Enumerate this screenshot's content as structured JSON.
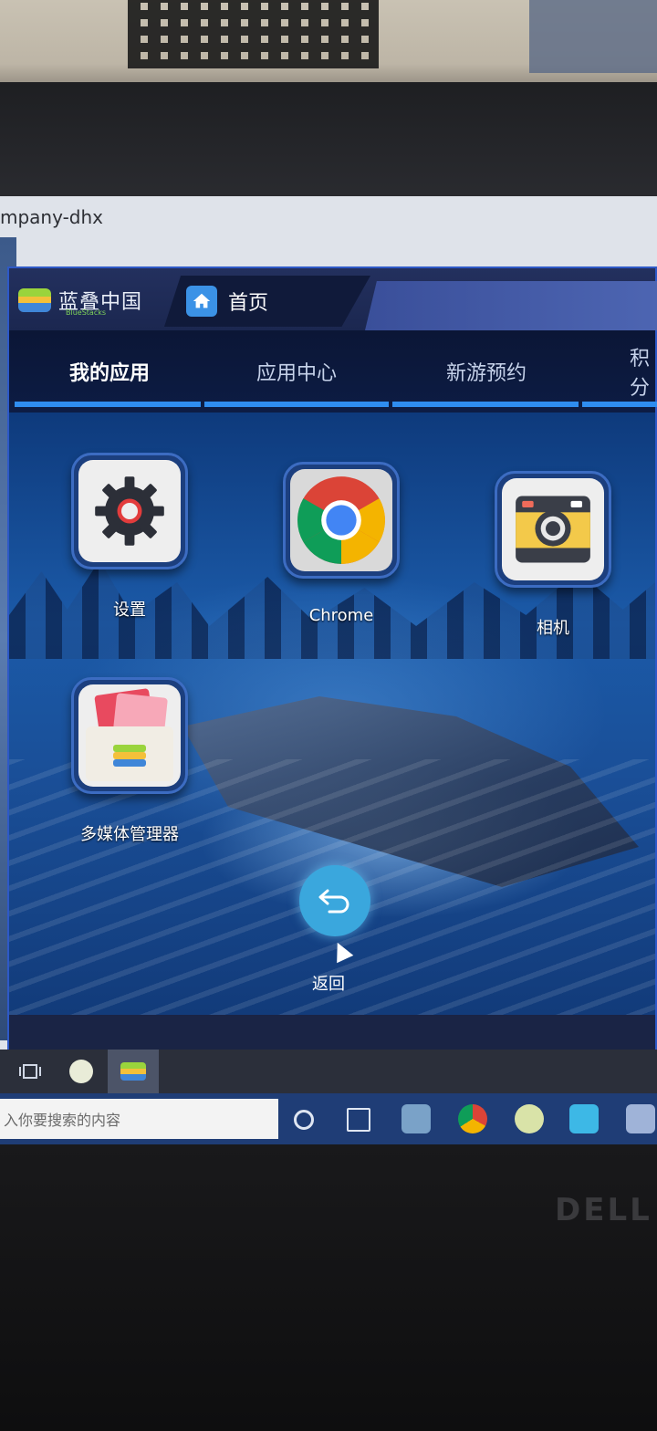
{
  "desktop": {
    "window_caption": "mpany-dhx"
  },
  "emulator": {
    "brand": "蓝叠中国",
    "brand_sub": "BlueStacks",
    "home_tab": "首页",
    "nav_tabs": [
      {
        "label": "我的应用",
        "active": true
      },
      {
        "label": "应用中心",
        "active": false
      },
      {
        "label": "新游预约",
        "active": false
      },
      {
        "label": "积分",
        "active": false
      }
    ],
    "apps": [
      {
        "label": "设置",
        "icon": "gear-icon"
      },
      {
        "label": "Chrome",
        "icon": "chrome-icon"
      },
      {
        "label": "相机",
        "icon": "camera-icon"
      },
      {
        "label": "多媒体管理器",
        "icon": "media-manager-icon"
      }
    ],
    "back_label": "返回"
  },
  "taskbar": {
    "search_placeholder": "入你要搜索的内容"
  },
  "monitor_brand": "DELL",
  "colors": {
    "accent": "#2f8df0",
    "titlebar": "#23305e",
    "back_button": "#3aa7dd"
  }
}
